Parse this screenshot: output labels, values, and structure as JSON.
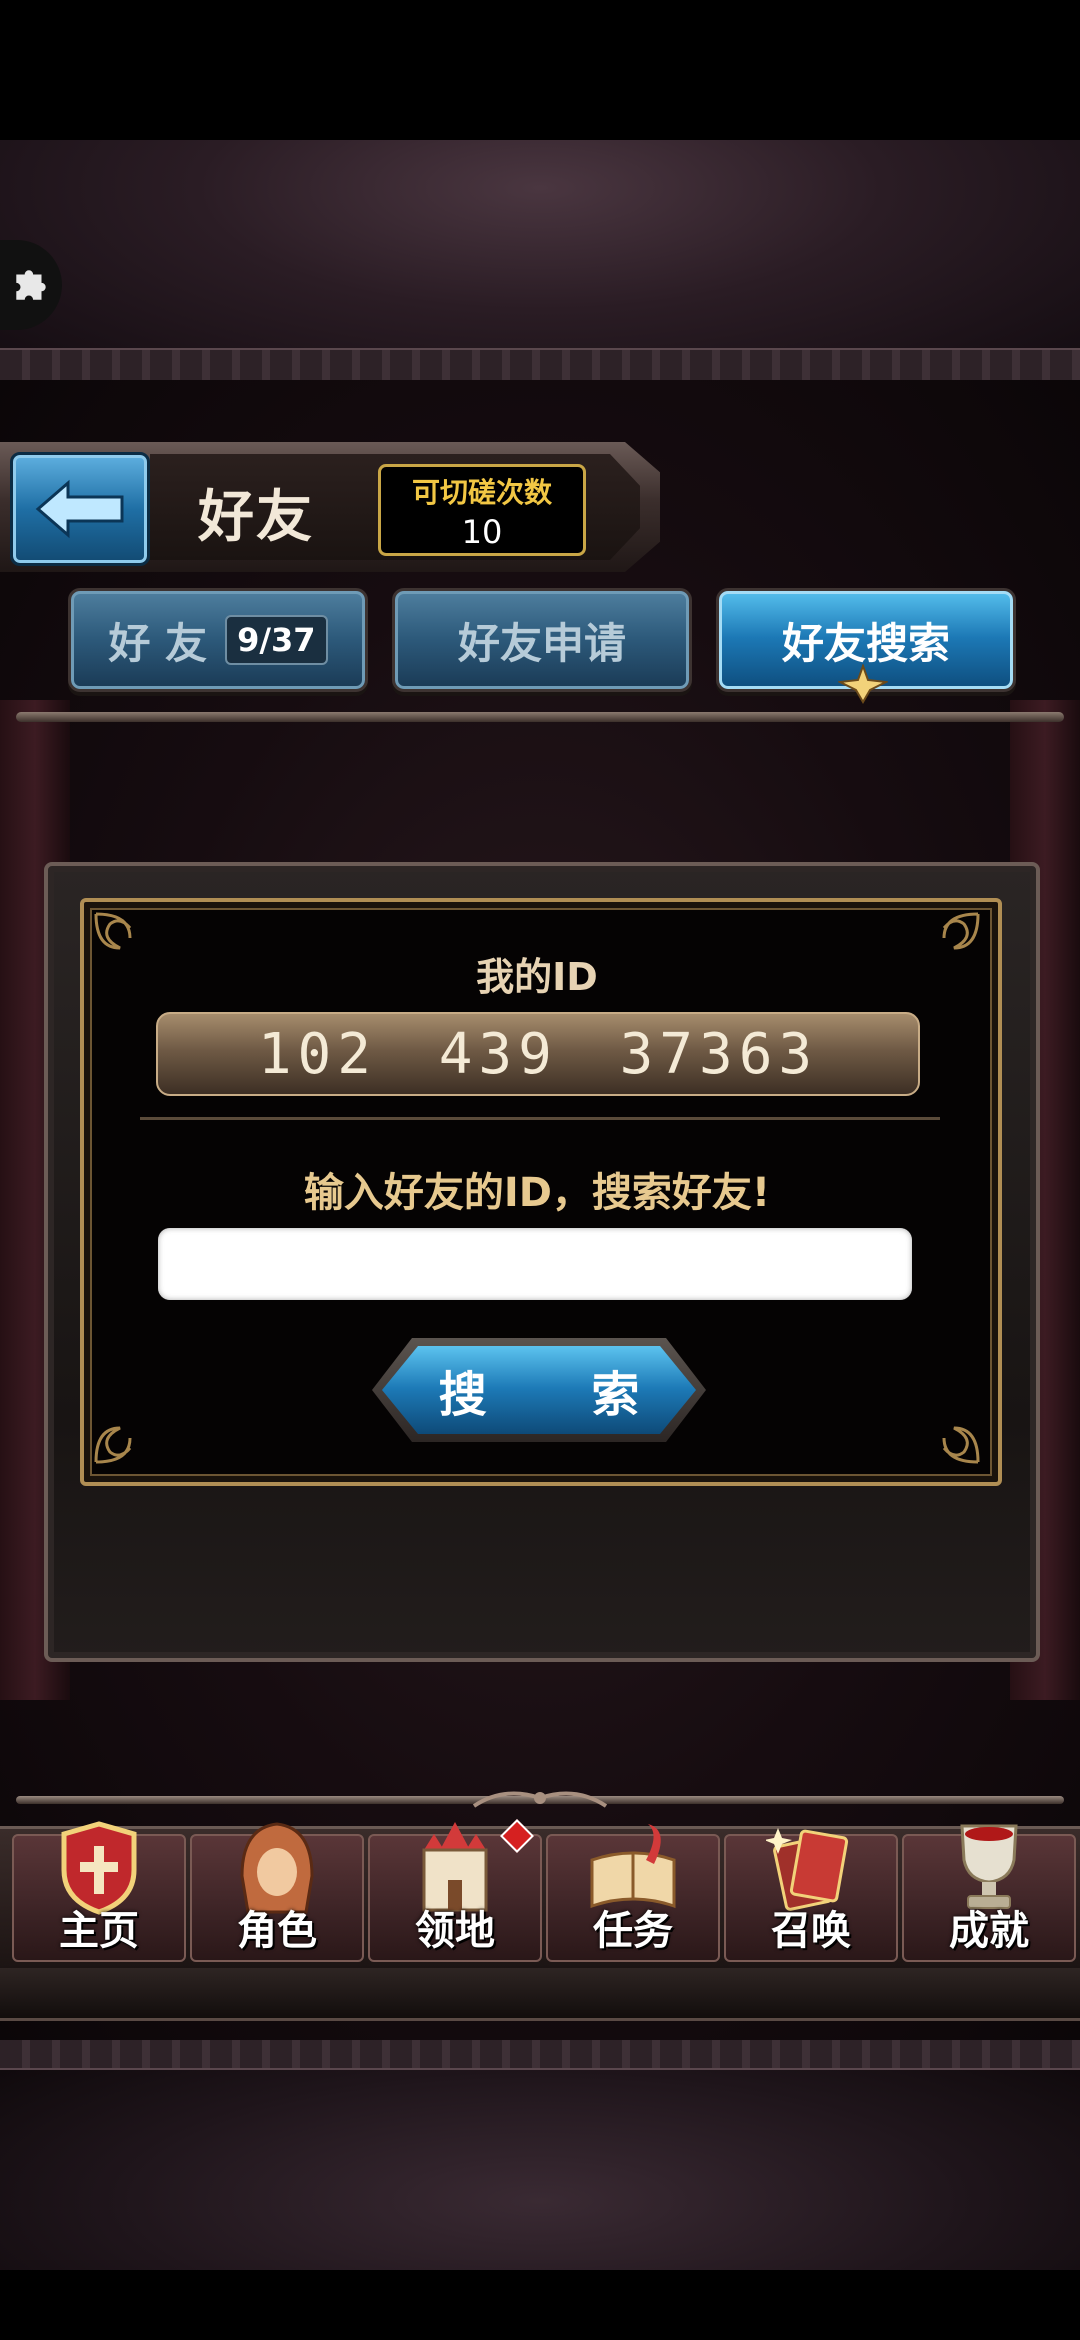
{
  "header": {
    "title": "好友",
    "counter_label": "可切磋次数",
    "counter_value": "10"
  },
  "tabs": [
    {
      "label": "好 友",
      "badge": "9/37",
      "active": false
    },
    {
      "label": "好友申请",
      "active": false
    },
    {
      "label": "好友搜索",
      "active": true
    }
  ],
  "panel": {
    "my_id_label": "我的ID",
    "my_id_value": "102 439 37363",
    "prompt": "输入好友的ID，搜索好友!",
    "input_value": "",
    "search_button": "搜 索"
  },
  "nav": {
    "items": [
      {
        "label": "主页",
        "icon": "shield-cross-icon"
      },
      {
        "label": "角色",
        "icon": "hooded-character-icon"
      },
      {
        "label": "领地",
        "icon": "castle-icon"
      },
      {
        "label": "任务",
        "icon": "quest-book-icon"
      },
      {
        "label": "召唤",
        "icon": "summon-card-icon"
      },
      {
        "label": "成就",
        "icon": "trophy-icon"
      }
    ]
  },
  "colors": {
    "accent_blue": "#1c78b5",
    "gold": "#c9a646",
    "nav_red": "#5a3638"
  }
}
